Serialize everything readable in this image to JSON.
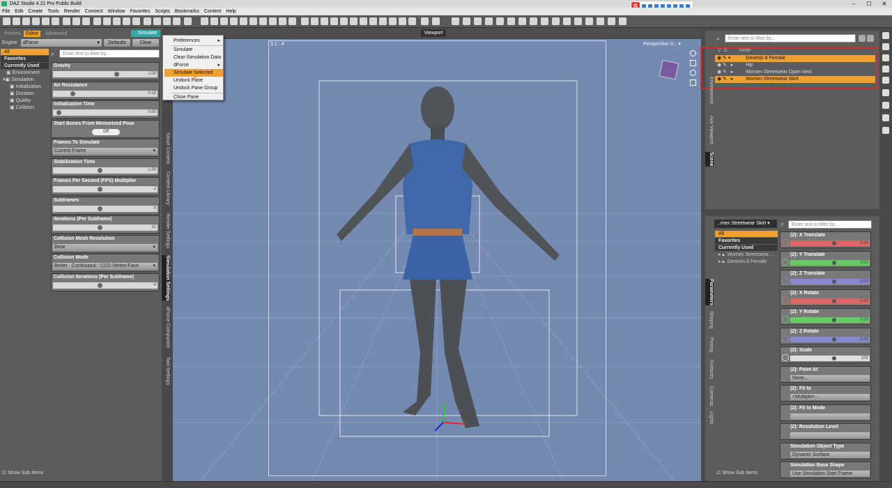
{
  "app": {
    "title": "DAZ Studio 4.21 Pro Public Build"
  },
  "menubar": [
    "File",
    "Edit",
    "Create",
    "Tools",
    "Render",
    "Connect",
    "Window",
    "Favorites",
    "Scripts",
    "Bookmarks",
    "Content",
    "Help"
  ],
  "left_pane": {
    "tabs": [
      "Presets",
      "Editor",
      "Advanced"
    ],
    "simulate_button": "Simulate",
    "engine_label": "Engine",
    "engine_value": "dForce",
    "defaults_button": "Defaults",
    "clear_button": "Clear",
    "filter_placeholder": "Enter text to filter by...",
    "categories": [
      "All",
      "Favorites",
      "Currently Used"
    ],
    "tree": [
      "Environment",
      "Simulation",
      "Initialization",
      "Duration",
      "Quality",
      "Collision"
    ],
    "properties": [
      {
        "label": "Gravity",
        "kind": "slider",
        "value": "1.00",
        "level": 0.64
      },
      {
        "label": "Air Resistance",
        "kind": "slider",
        "value": "0.15",
        "level": 0.15
      },
      {
        "label": "Initialization Time",
        "kind": "slider",
        "value": "0.00",
        "level": 0.0
      },
      {
        "label": "Start Bones From Memorized Pose",
        "kind": "toggle",
        "value": "Off"
      },
      {
        "label": "Frames To Simulate",
        "kind": "dropdown",
        "value": "Current Frame"
      },
      {
        "label": "Stabilization Time",
        "kind": "slider",
        "value": "1.00",
        "level": 0.45
      },
      {
        "label": "Frames Per Second (FPS) Multiplier",
        "kind": "slider",
        "value": "2",
        "level": 0.45
      },
      {
        "label": "Subframes",
        "kind": "slider",
        "value": "8",
        "level": 0.45
      },
      {
        "label": "Iterations (Per Subframe)",
        "kind": "slider",
        "value": "32",
        "level": 0.45
      },
      {
        "label": "Collision Mesh Resolution",
        "kind": "dropdown",
        "value": "Base"
      },
      {
        "label": "Collision Mode",
        "kind": "dropdown",
        "value": "Better - Continuous : CCD Vertex-Face"
      },
      {
        "label": "Collision Iterations (Per Subframe)",
        "kind": "slider",
        "value": "4",
        "level": 0.45
      }
    ],
    "vertical_tabs": [
      "Smart Content",
      "Content Library",
      "Render Settings",
      "Simulation Settings",
      "dForce Companion",
      "Tool Settings"
    ],
    "show_sub_items": "Show Sub Items"
  },
  "context_menu": {
    "items": [
      "Preferences",
      "Simulate",
      "Clear Simulation Data",
      "dForce",
      "Simulate Selected",
      "Undock Pane",
      "Undock Pane Group",
      "Close Pane"
    ],
    "highlighted": "Simulate Selected"
  },
  "viewport": {
    "tab_label": "Viewport",
    "coord": "3.1 : 4",
    "camera": "Perspective V..."
  },
  "scene_pane": {
    "filter_placeholder": "Enter text to filter by...",
    "header": "Node",
    "nodes": [
      {
        "label": "Genesis 8 Female",
        "selected": true
      },
      {
        "label": "Hip",
        "selected": false
      },
      {
        "label": "Women Streetwear Open Vest",
        "selected": false
      },
      {
        "label": "Women Streetwear Skirt",
        "selected": true
      }
    ],
    "vertical_tabs": [
      "Environment",
      "Aux Viewport",
      "Scene"
    ]
  },
  "params_pane": {
    "node_select": "...men Streetwear Skirt",
    "filter_placeholder": "Enter text to filter by...",
    "categories": [
      "All",
      "Favorites",
      "Currently Used"
    ],
    "nodes": [
      "Women Streetwear ...",
      "Genesis 8 Female"
    ],
    "properties": [
      {
        "label": "(2): X Translate",
        "value": "0.00",
        "color": "#d66"
      },
      {
        "label": "(2): Y Translate",
        "value": "0.00",
        "color": "#6c6"
      },
      {
        "label": "(2): Z Translate",
        "value": "0.00",
        "color": "#88c"
      },
      {
        "label": "(2): X Rotate",
        "value": "0.00",
        "color": "#d66"
      },
      {
        "label": "(2): Y Rotate",
        "value": "0.00",
        "color": "#6c6"
      },
      {
        "label": "(2): Z Rotate",
        "value": "0.00",
        "color": "#88c"
      },
      {
        "label": "(2): Scale",
        "value": "100",
        "color": "#ddd"
      },
      {
        "label": "(2): Point At",
        "value": "None...",
        "color": "#bbb"
      },
      {
        "label": "(2): Fit to",
        "value": "<Multiple>...",
        "color": "#bbb"
      },
      {
        "label": "(2): Fit to Mode",
        "value": "",
        "color": "#bbb"
      },
      {
        "label": "(2): Resolution Level",
        "value": "",
        "color": "#bbb"
      },
      {
        "label": "Simulation Object Type",
        "value": "Dynamic Surface",
        "color": "#bbb"
      },
      {
        "label": "Simulation Base Shape",
        "value": "Use Simulation Start Frame",
        "color": "#bbb"
      }
    ],
    "vertical_tabs": [
      "Parameters",
      "Shaping",
      "Posing",
      "Surfaces",
      "Cameras",
      "Lights"
    ],
    "show_sub_items": "Show Sub Items"
  }
}
